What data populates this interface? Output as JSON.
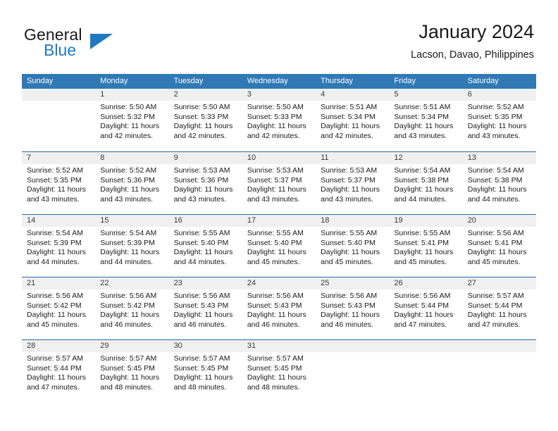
{
  "brand": {
    "name_part1": "General",
    "name_part2": "Blue",
    "triangle_color": "#1f78c1"
  },
  "header": {
    "title": "January 2024",
    "subtitle": "Lacson, Davao, Philippines"
  },
  "colors": {
    "header_bar": "#3079b5",
    "day_band": "#f0f0f0",
    "row_border": "#2a6ca5",
    "text": "#1a1a1a"
  },
  "weekdays": [
    "Sunday",
    "Monday",
    "Tuesday",
    "Wednesday",
    "Thursday",
    "Friday",
    "Saturday"
  ],
  "weeks": [
    [
      {
        "day": "",
        "sunrise": "",
        "sunset": "",
        "daylight1": "",
        "daylight2": "",
        "empty": true
      },
      {
        "day": "1",
        "sunrise": "Sunrise: 5:50 AM",
        "sunset": "Sunset: 5:32 PM",
        "daylight1": "Daylight: 11 hours",
        "daylight2": "and 42 minutes."
      },
      {
        "day": "2",
        "sunrise": "Sunrise: 5:50 AM",
        "sunset": "Sunset: 5:33 PM",
        "daylight1": "Daylight: 11 hours",
        "daylight2": "and 42 minutes."
      },
      {
        "day": "3",
        "sunrise": "Sunrise: 5:50 AM",
        "sunset": "Sunset: 5:33 PM",
        "daylight1": "Daylight: 11 hours",
        "daylight2": "and 42 minutes."
      },
      {
        "day": "4",
        "sunrise": "Sunrise: 5:51 AM",
        "sunset": "Sunset: 5:34 PM",
        "daylight1": "Daylight: 11 hours",
        "daylight2": "and 42 minutes."
      },
      {
        "day": "5",
        "sunrise": "Sunrise: 5:51 AM",
        "sunset": "Sunset: 5:34 PM",
        "daylight1": "Daylight: 11 hours",
        "daylight2": "and 43 minutes."
      },
      {
        "day": "6",
        "sunrise": "Sunrise: 5:52 AM",
        "sunset": "Sunset: 5:35 PM",
        "daylight1": "Daylight: 11 hours",
        "daylight2": "and 43 minutes."
      }
    ],
    [
      {
        "day": "7",
        "sunrise": "Sunrise: 5:52 AM",
        "sunset": "Sunset: 5:35 PM",
        "daylight1": "Daylight: 11 hours",
        "daylight2": "and 43 minutes."
      },
      {
        "day": "8",
        "sunrise": "Sunrise: 5:52 AM",
        "sunset": "Sunset: 5:36 PM",
        "daylight1": "Daylight: 11 hours",
        "daylight2": "and 43 minutes."
      },
      {
        "day": "9",
        "sunrise": "Sunrise: 5:53 AM",
        "sunset": "Sunset: 5:36 PM",
        "daylight1": "Daylight: 11 hours",
        "daylight2": "and 43 minutes."
      },
      {
        "day": "10",
        "sunrise": "Sunrise: 5:53 AM",
        "sunset": "Sunset: 5:37 PM",
        "daylight1": "Daylight: 11 hours",
        "daylight2": "and 43 minutes."
      },
      {
        "day": "11",
        "sunrise": "Sunrise: 5:53 AM",
        "sunset": "Sunset: 5:37 PM",
        "daylight1": "Daylight: 11 hours",
        "daylight2": "and 43 minutes."
      },
      {
        "day": "12",
        "sunrise": "Sunrise: 5:54 AM",
        "sunset": "Sunset: 5:38 PM",
        "daylight1": "Daylight: 11 hours",
        "daylight2": "and 44 minutes."
      },
      {
        "day": "13",
        "sunrise": "Sunrise: 5:54 AM",
        "sunset": "Sunset: 5:38 PM",
        "daylight1": "Daylight: 11 hours",
        "daylight2": "and 44 minutes."
      }
    ],
    [
      {
        "day": "14",
        "sunrise": "Sunrise: 5:54 AM",
        "sunset": "Sunset: 5:39 PM",
        "daylight1": "Daylight: 11 hours",
        "daylight2": "and 44 minutes."
      },
      {
        "day": "15",
        "sunrise": "Sunrise: 5:54 AM",
        "sunset": "Sunset: 5:39 PM",
        "daylight1": "Daylight: 11 hours",
        "daylight2": "and 44 minutes."
      },
      {
        "day": "16",
        "sunrise": "Sunrise: 5:55 AM",
        "sunset": "Sunset: 5:40 PM",
        "daylight1": "Daylight: 11 hours",
        "daylight2": "and 44 minutes."
      },
      {
        "day": "17",
        "sunrise": "Sunrise: 5:55 AM",
        "sunset": "Sunset: 5:40 PM",
        "daylight1": "Daylight: 11 hours",
        "daylight2": "and 45 minutes."
      },
      {
        "day": "18",
        "sunrise": "Sunrise: 5:55 AM",
        "sunset": "Sunset: 5:40 PM",
        "daylight1": "Daylight: 11 hours",
        "daylight2": "and 45 minutes."
      },
      {
        "day": "19",
        "sunrise": "Sunrise: 5:55 AM",
        "sunset": "Sunset: 5:41 PM",
        "daylight1": "Daylight: 11 hours",
        "daylight2": "and 45 minutes."
      },
      {
        "day": "20",
        "sunrise": "Sunrise: 5:56 AM",
        "sunset": "Sunset: 5:41 PM",
        "daylight1": "Daylight: 11 hours",
        "daylight2": "and 45 minutes."
      }
    ],
    [
      {
        "day": "21",
        "sunrise": "Sunrise: 5:56 AM",
        "sunset": "Sunset: 5:42 PM",
        "daylight1": "Daylight: 11 hours",
        "daylight2": "and 45 minutes."
      },
      {
        "day": "22",
        "sunrise": "Sunrise: 5:56 AM",
        "sunset": "Sunset: 5:42 PM",
        "daylight1": "Daylight: 11 hours",
        "daylight2": "and 46 minutes."
      },
      {
        "day": "23",
        "sunrise": "Sunrise: 5:56 AM",
        "sunset": "Sunset: 5:43 PM",
        "daylight1": "Daylight: 11 hours",
        "daylight2": "and 46 minutes."
      },
      {
        "day": "24",
        "sunrise": "Sunrise: 5:56 AM",
        "sunset": "Sunset: 5:43 PM",
        "daylight1": "Daylight: 11 hours",
        "daylight2": "and 46 minutes."
      },
      {
        "day": "25",
        "sunrise": "Sunrise: 5:56 AM",
        "sunset": "Sunset: 5:43 PM",
        "daylight1": "Daylight: 11 hours",
        "daylight2": "and 46 minutes."
      },
      {
        "day": "26",
        "sunrise": "Sunrise: 5:56 AM",
        "sunset": "Sunset: 5:44 PM",
        "daylight1": "Daylight: 11 hours",
        "daylight2": "and 47 minutes."
      },
      {
        "day": "27",
        "sunrise": "Sunrise: 5:57 AM",
        "sunset": "Sunset: 5:44 PM",
        "daylight1": "Daylight: 11 hours",
        "daylight2": "and 47 minutes."
      }
    ],
    [
      {
        "day": "28",
        "sunrise": "Sunrise: 5:57 AM",
        "sunset": "Sunset: 5:44 PM",
        "daylight1": "Daylight: 11 hours",
        "daylight2": "and 47 minutes."
      },
      {
        "day": "29",
        "sunrise": "Sunrise: 5:57 AM",
        "sunset": "Sunset: 5:45 PM",
        "daylight1": "Daylight: 11 hours",
        "daylight2": "and 48 minutes."
      },
      {
        "day": "30",
        "sunrise": "Sunrise: 5:57 AM",
        "sunset": "Sunset: 5:45 PM",
        "daylight1": "Daylight: 11 hours",
        "daylight2": "and 48 minutes."
      },
      {
        "day": "31",
        "sunrise": "Sunrise: 5:57 AM",
        "sunset": "Sunset: 5:45 PM",
        "daylight1": "Daylight: 11 hours",
        "daylight2": "and 48 minutes."
      },
      {
        "day": "",
        "sunrise": "",
        "sunset": "",
        "daylight1": "",
        "daylight2": "",
        "empty": true
      },
      {
        "day": "",
        "sunrise": "",
        "sunset": "",
        "daylight1": "",
        "daylight2": "",
        "empty": true
      },
      {
        "day": "",
        "sunrise": "",
        "sunset": "",
        "daylight1": "",
        "daylight2": "",
        "empty": true
      }
    ]
  ]
}
